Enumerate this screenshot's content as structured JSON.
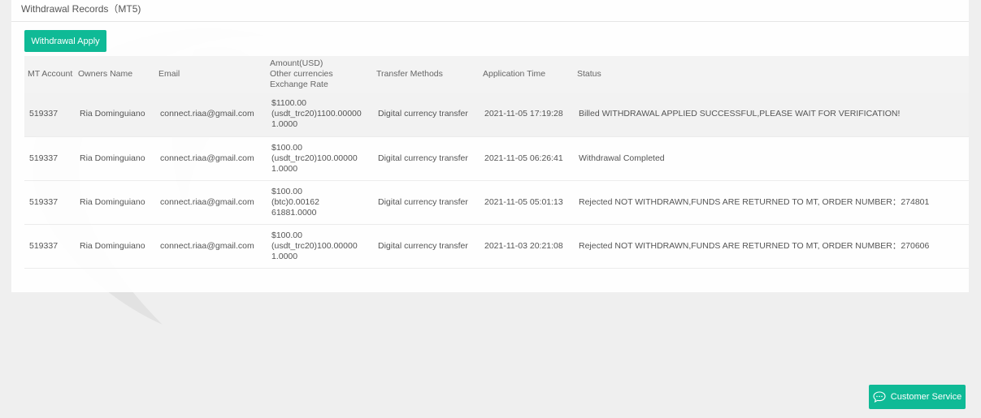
{
  "header": {
    "title": "Withdrawal Records（MT5)"
  },
  "toolbar": {
    "apply_label": "Withdrawal Apply"
  },
  "table": {
    "columns": {
      "account": "MT Account",
      "owner": "Owners Name",
      "email": "Email",
      "amount_1": "Amount(USD)",
      "amount_2": "Other currencies",
      "amount_3": "Exchange Rate",
      "method": "Transfer Methods",
      "time": "Application Time",
      "status": "Status"
    },
    "rows": [
      {
        "account": "519337",
        "owner": "Ria Dominguiano",
        "email": "connect.riaa@gmail.com",
        "amount_usd": "$1100.00",
        "other": "(usdt_trc20)1100.00000",
        "rate": "1.0000",
        "method": "Digital currency transfer",
        "time": "2021-11-05 17:19:28",
        "status": "Billed WITHDRAWAL APPLIED SUCCESSFUL,PLEASE WAIT FOR VERIFICATION!"
      },
      {
        "account": "519337",
        "owner": "Ria Dominguiano",
        "email": "connect.riaa@gmail.com",
        "amount_usd": "$100.00",
        "other": "(usdt_trc20)100.00000",
        "rate": "1.0000",
        "method": "Digital currency transfer",
        "time": "2021-11-05 06:26:41",
        "status": "Withdrawal Completed"
      },
      {
        "account": "519337",
        "owner": "Ria Dominguiano",
        "email": "connect.riaa@gmail.com",
        "amount_usd": "$100.00",
        "other": "(btc)0.00162",
        "rate": "61881.0000",
        "method": "Digital currency transfer",
        "time": "2021-11-05 05:01:13",
        "status": "Rejected NOT WITHDRAWN,FUNDS ARE RETURNED TO MT, ORDER NUMBER：274801"
      },
      {
        "account": "519337",
        "owner": "Ria Dominguiano",
        "email": "connect.riaa@gmail.com",
        "amount_usd": "$100.00",
        "other": "(usdt_trc20)100.00000",
        "rate": "1.0000",
        "method": "Digital currency transfer",
        "time": "2021-11-03 20:21:08",
        "status": "Rejected NOT WITHDRAWN,FUNDS ARE RETURNED TO MT, ORDER NUMBER：270606"
      }
    ]
  },
  "support": {
    "label": "Customer Service",
    "icon": "chat-bubble-icon"
  },
  "colors": {
    "accent": "#0fba96",
    "background": "#efefef",
    "panel": "#ffffff"
  }
}
